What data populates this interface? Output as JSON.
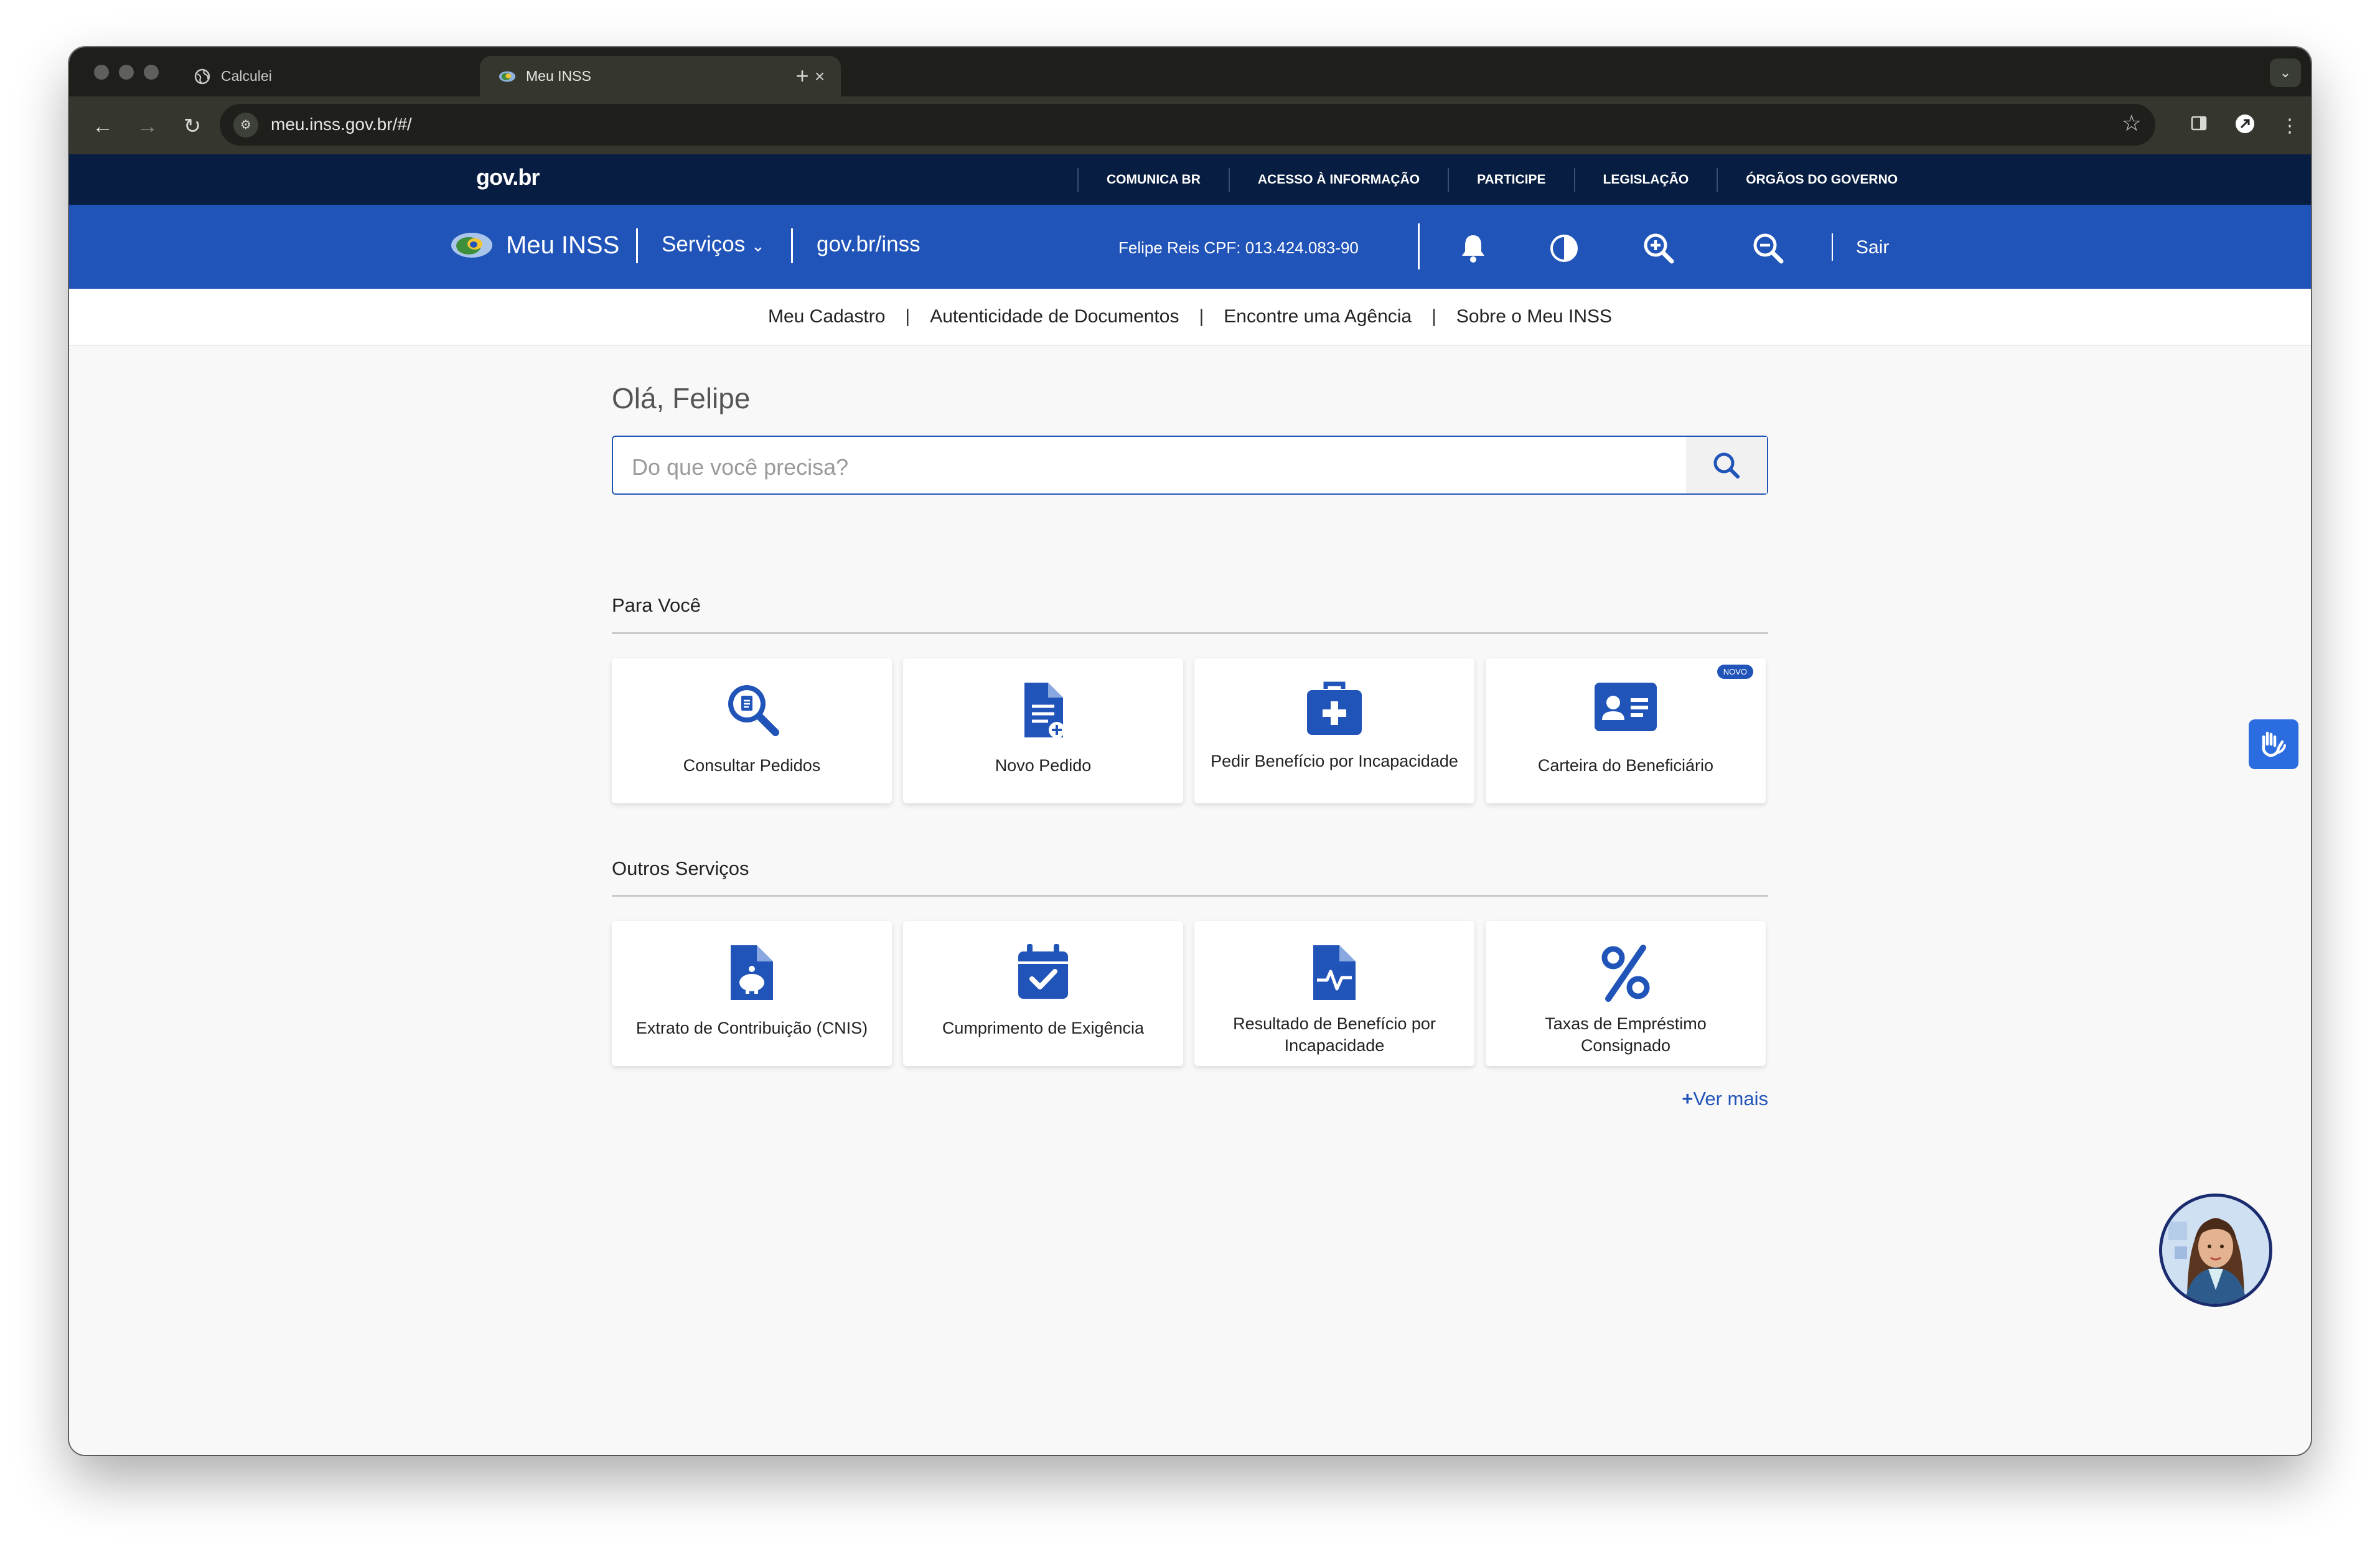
{
  "browser": {
    "tabs": [
      {
        "title": "Calculei",
        "icon": "globe-icon"
      },
      {
        "title": "Meu INSS",
        "icon": "inss-logo-icon"
      }
    ],
    "new_tab": "+",
    "url": "meu.inss.gov.br/#/"
  },
  "govbar": {
    "logo": "gov.br",
    "links": [
      "COMUNICA BR",
      "ACESSO À INFORMAÇÃO",
      "PARTICIPE",
      "LEGISLAÇÃO",
      "ÓRGÃOS DO GOVERNO"
    ]
  },
  "header": {
    "brand": "Meu INSS",
    "servicos": "Serviços",
    "govinss": "gov.br/inss",
    "user": "Felipe Reis  CPF: 013.424.083-90",
    "sair": "Sair",
    "icons": [
      "bell-icon",
      "contrast-icon",
      "zoom-in-icon",
      "zoom-out-icon"
    ],
    "brand_color": "#2154b8"
  },
  "subnav": [
    "Meu Cadastro",
    "Autenticidade de Documentos",
    "Encontre uma Agência",
    "Sobre o Meu INSS"
  ],
  "main": {
    "greeting": "Olá, Felipe",
    "search_placeholder": "Do que você precisa?",
    "para_voce": {
      "title": "Para Você",
      "cards": [
        {
          "label": "Consultar Pedidos",
          "icon": "magnifier-document-icon"
        },
        {
          "label": "Novo Pedido",
          "icon": "new-document-icon"
        },
        {
          "label": "Pedir Benefício por Incapacidade",
          "icon": "medical-kit-icon"
        },
        {
          "label": "Carteira do Beneficiário",
          "icon": "id-card-icon",
          "badge": "NOVO"
        }
      ]
    },
    "outros_servicos": {
      "title": "Outros Serviços",
      "cards": [
        {
          "label": "Extrato de Contribuição (CNIS)",
          "icon": "piggy-bank-document-icon"
        },
        {
          "label": "Cumprimento de Exigência",
          "icon": "calendar-check-icon"
        },
        {
          "label": "Resultado de Benefício por Incapacidade",
          "icon": "heartbeat-document-icon"
        },
        {
          "label": "Taxas de Empréstimo Consignado",
          "icon": "percent-icon"
        }
      ]
    },
    "ver_mais": "Ver mais"
  }
}
